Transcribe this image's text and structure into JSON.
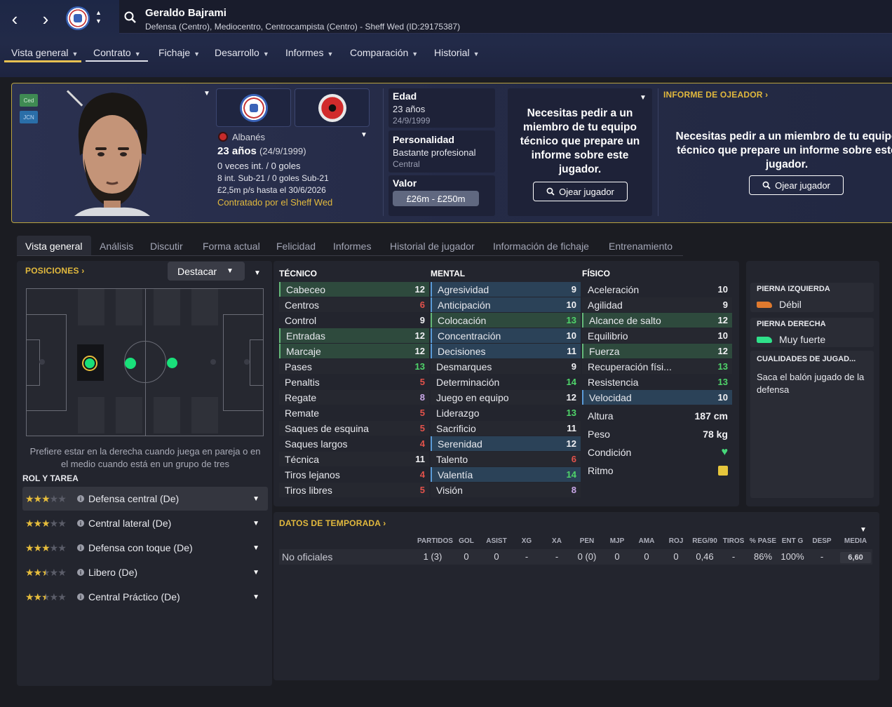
{
  "header": {
    "player_name": "Geraldo Bajrami",
    "player_subtitle": "Defensa (Centro), Mediocentro, Centrocampista (Centro) - Sheff Wed (ID:29175387)",
    "nav_back": "‹",
    "nav_forward": "›"
  },
  "main_tabs": [
    {
      "label": "Vista general"
    },
    {
      "label": "Contrato"
    },
    {
      "label": "Fichaje"
    },
    {
      "label": "Desarrollo"
    },
    {
      "label": "Informes"
    },
    {
      "label": "Comparación"
    },
    {
      "label": "Historial"
    }
  ],
  "profile": {
    "tag_ced": "Ced",
    "tag_jcn": "JCN",
    "nationality": "Albanés",
    "age_line": "23 años",
    "dob_paren": "(24/9/1999)",
    "caps": "0 veces int. / 0 goles",
    "u21": "8 int. Sub-21 / 0 goles Sub-21",
    "wage": "£2,5m p/s hasta el 30/6/2026",
    "signed": "Contratado por el Sheff Wed"
  },
  "info": {
    "age_label": "Edad",
    "age_value": "23 años",
    "dob": "24/9/1999",
    "personality_label": "Personalidad",
    "personality_value": "Bastante profesional",
    "media_handling": "Central",
    "value_label": "Valor",
    "value_range": "£26m - £250m"
  },
  "report": {
    "message_left": "Necesitas pedir a un miembro de tu equipo técnico que prepare un informe sobre este jugador.",
    "scout_button": "Ojear jugador",
    "title": "INFORME DE OJEADOR",
    "message_right": "Necesitas pedir a un miembro de tu equipo técnico que prepare un informe sobre este jugador.",
    "scout_button_right": "Ojear jugador"
  },
  "sub_tabs": [
    {
      "label": "Vista general"
    },
    {
      "label": "Análisis"
    },
    {
      "label": "Discutir"
    },
    {
      "label": "Forma actual"
    },
    {
      "label": "Felicidad"
    },
    {
      "label": "Informes"
    },
    {
      "label": "Historial de jugador"
    },
    {
      "label": "Información de fichaje"
    },
    {
      "label": "Entrenamiento"
    }
  ],
  "positions": {
    "title": "POSICIONES",
    "dropdown": "Destacar",
    "note": "Prefiere estar en la derecha cuando juega en pareja o en el medio cuando está en un grupo de tres",
    "roles_title": "ROL Y TAREA",
    "roles": [
      {
        "name": "Defensa central (De)",
        "stars": 3
      },
      {
        "name": "Central lateral (De)",
        "stars": 3
      },
      {
        "name": "Defensa con toque (De)",
        "stars": 3
      },
      {
        "name": "Libero (De)",
        "stars": 2.5
      },
      {
        "name": "Central Práctico (De)",
        "stars": 2.5
      }
    ]
  },
  "attributes": {
    "technical_title": "TÉCNICO",
    "mental_title": "MENTAL",
    "physical_title": "FÍSICO",
    "technical": [
      {
        "name": "Cabeceo",
        "value": "12"
      },
      {
        "name": "Centros",
        "value": "6"
      },
      {
        "name": "Control",
        "value": "9"
      },
      {
        "name": "Entradas",
        "value": "12"
      },
      {
        "name": "Marcaje",
        "value": "12"
      },
      {
        "name": "Pases",
        "value": "13"
      },
      {
        "name": "Penaltis",
        "value": "5"
      },
      {
        "name": "Regate",
        "value": "8"
      },
      {
        "name": "Remate",
        "value": "5"
      },
      {
        "name": "Saques de esquina",
        "value": "5"
      },
      {
        "name": "Saques largos",
        "value": "4"
      },
      {
        "name": "Técnica",
        "value": "11"
      },
      {
        "name": "Tiros lejanos",
        "value": "4"
      },
      {
        "name": "Tiros libres",
        "value": "5"
      }
    ],
    "mental": [
      {
        "name": "Agresividad",
        "value": "9"
      },
      {
        "name": "Anticipación",
        "value": "10"
      },
      {
        "name": "Colocación",
        "value": "13"
      },
      {
        "name": "Concentración",
        "value": "10"
      },
      {
        "name": "Decisiones",
        "value": "11"
      },
      {
        "name": "Desmarques",
        "value": "9"
      },
      {
        "name": "Determinación",
        "value": "14"
      },
      {
        "name": "Juego en equipo",
        "value": "12"
      },
      {
        "name": "Liderazgo",
        "value": "13"
      },
      {
        "name": "Sacrificio",
        "value": "11"
      },
      {
        "name": "Serenidad",
        "value": "12"
      },
      {
        "name": "Talento",
        "value": "6"
      },
      {
        "name": "Valentía",
        "value": "14"
      },
      {
        "name": "Visión",
        "value": "8"
      }
    ],
    "physical": [
      {
        "name": "Aceleración",
        "value": "10"
      },
      {
        "name": "Agilidad",
        "value": "9"
      },
      {
        "name": "Alcance de salto",
        "value": "12"
      },
      {
        "name": "Equilibrio",
        "value": "10"
      },
      {
        "name": "Fuerza",
        "value": "12"
      },
      {
        "name": "Recuperación físi...",
        "value": "13"
      },
      {
        "name": "Resistencia",
        "value": "13"
      },
      {
        "name": "Velocidad",
        "value": "10"
      }
    ],
    "height_label": "Altura",
    "height_value": "187 cm",
    "weight_label": "Peso",
    "weight_value": "78 kg",
    "condition_label": "Condición",
    "sharpness_label": "Ritmo"
  },
  "side": {
    "left_foot_title": "PIERNA IZQUIERDA",
    "left_foot_value": "Débil",
    "right_foot_title": "PIERNA DERECHA",
    "right_foot_value": "Muy fuerte",
    "traits_title": "CUALIDADES DE JUGAD...",
    "trait": "Saca el balón jugado de la defensa"
  },
  "season": {
    "title": "DATOS DE TEMPORADA",
    "columns": [
      "PARTIDOS",
      "GOL",
      "ASIST",
      "XG",
      "XA",
      "PEN",
      "MJP",
      "AMA",
      "ROJ",
      "REG/90",
      "TIROS",
      "% PASE",
      "ENT G",
      "DESP",
      "MEDIA"
    ],
    "row_label": "No oficiales",
    "row_values": [
      "1 (3)",
      "0",
      "0",
      "-",
      "-",
      "0 (0)",
      "0",
      "0",
      "0",
      "0,46",
      "-",
      "86%",
      "100%",
      "-",
      "6,60"
    ]
  },
  "colors": {
    "accent_gold": "#e2b93d",
    "green_value": "#4fd46a",
    "red_value": "#e3524b"
  }
}
